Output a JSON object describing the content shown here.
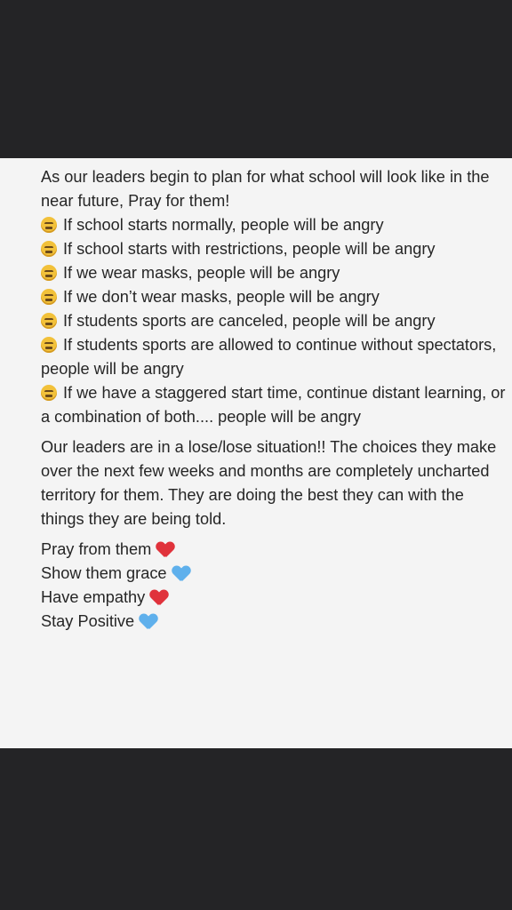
{
  "post": {
    "intro": "As our leaders begin to plan for what school will look like in the near future, Pray for them!",
    "scenarios": [
      {
        "icon": "weary-face-icon",
        "text": "If school starts normally, people will be angry"
      },
      {
        "icon": "weary-face-icon",
        "text": "If school starts with restrictions, people will be angry"
      },
      {
        "icon": "weary-face-icon",
        "text": "If we wear masks, people will be angry"
      },
      {
        "icon": "weary-face-icon",
        "text": "If we don’t wear masks, people will be angry"
      },
      {
        "icon": "weary-face-icon",
        "text": "If students sports are canceled, people will be angry"
      },
      {
        "icon": "weary-face-icon",
        "text": "If students sports are allowed to continue without spectators, people will be angry"
      },
      {
        "icon": "weary-face-icon",
        "text": "If we have a staggered start time, continue distant learning, or a combination of both.... people will be angry"
      }
    ],
    "situation": "Our leaders are in a lose/lose situation!! The choices they make over the next few weeks and months are completely uncharted territory for them. They are doing the best they can with the things they are being told.",
    "closing": [
      {
        "text": "Pray from them",
        "icon": "red-heart-icon",
        "color": "#e0323b"
      },
      {
        "text": "Show them grace",
        "icon": "blue-heart-icon",
        "color": "#5fb0ec"
      },
      {
        "text": "Have empathy",
        "icon": "red-heart-icon",
        "color": "#e0323b"
      },
      {
        "text": "Stay Positive",
        "icon": "blue-heart-icon",
        "color": "#5fb0ec"
      }
    ]
  }
}
